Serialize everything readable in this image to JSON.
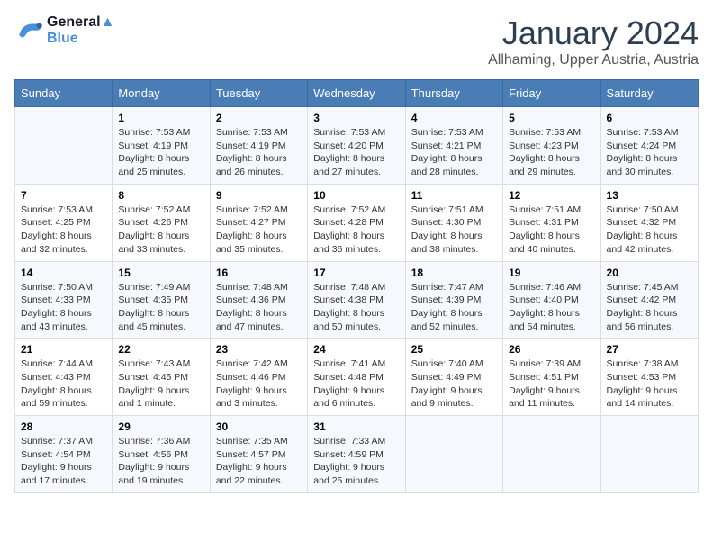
{
  "header": {
    "logo_line1": "General",
    "logo_line2": "Blue",
    "month": "January 2024",
    "location": "Allhaming, Upper Austria, Austria"
  },
  "weekdays": [
    "Sunday",
    "Monday",
    "Tuesday",
    "Wednesday",
    "Thursday",
    "Friday",
    "Saturday"
  ],
  "weeks": [
    [
      {
        "day": "",
        "text": ""
      },
      {
        "day": "1",
        "text": "Sunrise: 7:53 AM\nSunset: 4:19 PM\nDaylight: 8 hours\nand 25 minutes."
      },
      {
        "day": "2",
        "text": "Sunrise: 7:53 AM\nSunset: 4:19 PM\nDaylight: 8 hours\nand 26 minutes."
      },
      {
        "day": "3",
        "text": "Sunrise: 7:53 AM\nSunset: 4:20 PM\nDaylight: 8 hours\nand 27 minutes."
      },
      {
        "day": "4",
        "text": "Sunrise: 7:53 AM\nSunset: 4:21 PM\nDaylight: 8 hours\nand 28 minutes."
      },
      {
        "day": "5",
        "text": "Sunrise: 7:53 AM\nSunset: 4:23 PM\nDaylight: 8 hours\nand 29 minutes."
      },
      {
        "day": "6",
        "text": "Sunrise: 7:53 AM\nSunset: 4:24 PM\nDaylight: 8 hours\nand 30 minutes."
      }
    ],
    [
      {
        "day": "7",
        "text": "Sunrise: 7:53 AM\nSunset: 4:25 PM\nDaylight: 8 hours\nand 32 minutes."
      },
      {
        "day": "8",
        "text": "Sunrise: 7:52 AM\nSunset: 4:26 PM\nDaylight: 8 hours\nand 33 minutes."
      },
      {
        "day": "9",
        "text": "Sunrise: 7:52 AM\nSunset: 4:27 PM\nDaylight: 8 hours\nand 35 minutes."
      },
      {
        "day": "10",
        "text": "Sunrise: 7:52 AM\nSunset: 4:28 PM\nDaylight: 8 hours\nand 36 minutes."
      },
      {
        "day": "11",
        "text": "Sunrise: 7:51 AM\nSunset: 4:30 PM\nDaylight: 8 hours\nand 38 minutes."
      },
      {
        "day": "12",
        "text": "Sunrise: 7:51 AM\nSunset: 4:31 PM\nDaylight: 8 hours\nand 40 minutes."
      },
      {
        "day": "13",
        "text": "Sunrise: 7:50 AM\nSunset: 4:32 PM\nDaylight: 8 hours\nand 42 minutes."
      }
    ],
    [
      {
        "day": "14",
        "text": "Sunrise: 7:50 AM\nSunset: 4:33 PM\nDaylight: 8 hours\nand 43 minutes."
      },
      {
        "day": "15",
        "text": "Sunrise: 7:49 AM\nSunset: 4:35 PM\nDaylight: 8 hours\nand 45 minutes."
      },
      {
        "day": "16",
        "text": "Sunrise: 7:48 AM\nSunset: 4:36 PM\nDaylight: 8 hours\nand 47 minutes."
      },
      {
        "day": "17",
        "text": "Sunrise: 7:48 AM\nSunset: 4:38 PM\nDaylight: 8 hours\nand 50 minutes."
      },
      {
        "day": "18",
        "text": "Sunrise: 7:47 AM\nSunset: 4:39 PM\nDaylight: 8 hours\nand 52 minutes."
      },
      {
        "day": "19",
        "text": "Sunrise: 7:46 AM\nSunset: 4:40 PM\nDaylight: 8 hours\nand 54 minutes."
      },
      {
        "day": "20",
        "text": "Sunrise: 7:45 AM\nSunset: 4:42 PM\nDaylight: 8 hours\nand 56 minutes."
      }
    ],
    [
      {
        "day": "21",
        "text": "Sunrise: 7:44 AM\nSunset: 4:43 PM\nDaylight: 8 hours\nand 59 minutes."
      },
      {
        "day": "22",
        "text": "Sunrise: 7:43 AM\nSunset: 4:45 PM\nDaylight: 9 hours\nand 1 minute."
      },
      {
        "day": "23",
        "text": "Sunrise: 7:42 AM\nSunset: 4:46 PM\nDaylight: 9 hours\nand 3 minutes."
      },
      {
        "day": "24",
        "text": "Sunrise: 7:41 AM\nSunset: 4:48 PM\nDaylight: 9 hours\nand 6 minutes."
      },
      {
        "day": "25",
        "text": "Sunrise: 7:40 AM\nSunset: 4:49 PM\nDaylight: 9 hours\nand 9 minutes."
      },
      {
        "day": "26",
        "text": "Sunrise: 7:39 AM\nSunset: 4:51 PM\nDaylight: 9 hours\nand 11 minutes."
      },
      {
        "day": "27",
        "text": "Sunrise: 7:38 AM\nSunset: 4:53 PM\nDaylight: 9 hours\nand 14 minutes."
      }
    ],
    [
      {
        "day": "28",
        "text": "Sunrise: 7:37 AM\nSunset: 4:54 PM\nDaylight: 9 hours\nand 17 minutes."
      },
      {
        "day": "29",
        "text": "Sunrise: 7:36 AM\nSunset: 4:56 PM\nDaylight: 9 hours\nand 19 minutes."
      },
      {
        "day": "30",
        "text": "Sunrise: 7:35 AM\nSunset: 4:57 PM\nDaylight: 9 hours\nand 22 minutes."
      },
      {
        "day": "31",
        "text": "Sunrise: 7:33 AM\nSunset: 4:59 PM\nDaylight: 9 hours\nand 25 minutes."
      },
      {
        "day": "",
        "text": ""
      },
      {
        "day": "",
        "text": ""
      },
      {
        "day": "",
        "text": ""
      }
    ]
  ]
}
